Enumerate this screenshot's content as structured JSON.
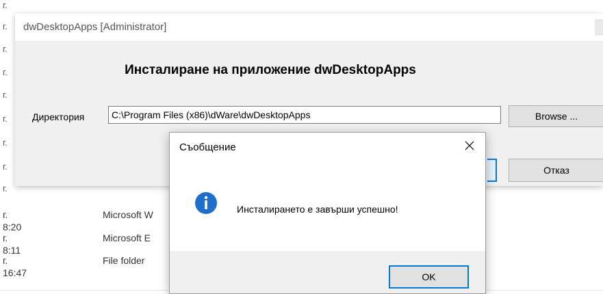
{
  "background": {
    "row_fragment": "г.",
    "rows": [
      {
        "date": "г. 8:20",
        "type": "Microsoft W"
      },
      {
        "date": "г. 8:11",
        "type": "Microsoft E"
      },
      {
        "date": "г. 16:47",
        "type": "File folder"
      }
    ]
  },
  "installer": {
    "title": "dwDesktopApps [Administrator]",
    "heading": "Инсталиране на приложение dwDesktopApps",
    "directory_label": "Директория",
    "directory_value": "C:\\Program Files (x86)\\dWare\\dwDesktopApps",
    "browse_label": "Browse ...",
    "cancel_label": "Отказ"
  },
  "dialog": {
    "title": "Съобщение",
    "message": "Инсталирането е завърши успешно!",
    "ok_label": "OK",
    "icon": "info-icon",
    "accent_color": "#0078d7"
  }
}
